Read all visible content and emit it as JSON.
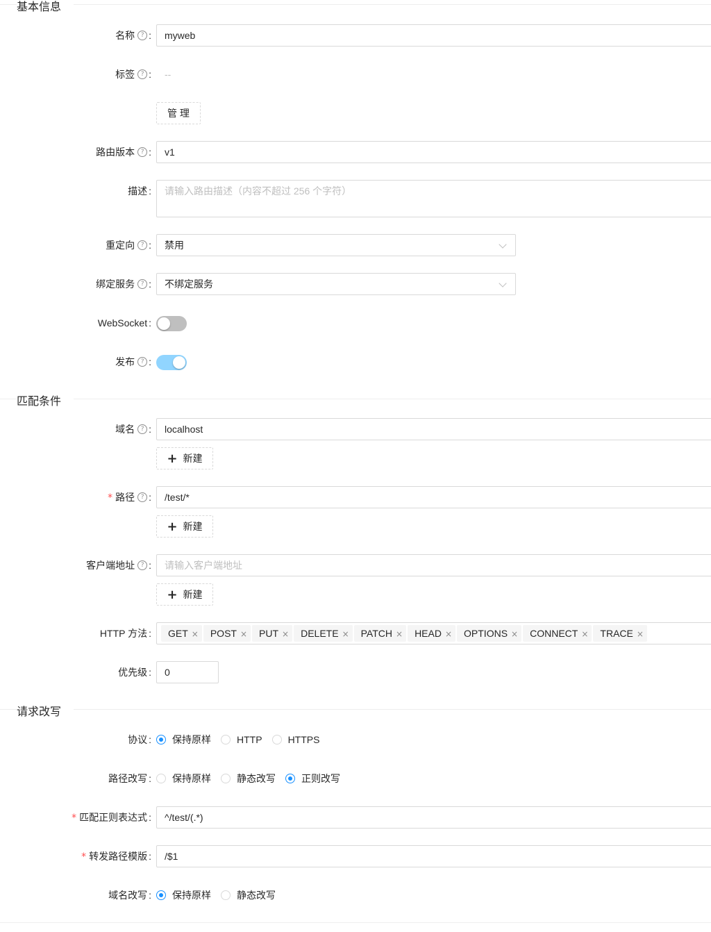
{
  "sections": {
    "basic": "基本信息",
    "match": "匹配条件",
    "rewrite": "请求改写"
  },
  "form": {
    "name": {
      "label": "名称",
      "value": "myweb"
    },
    "tags": {
      "label": "标签",
      "value": "--",
      "manage_button": "管 理"
    },
    "version": {
      "label": "路由版本",
      "value": "v1"
    },
    "description": {
      "label": "描述",
      "placeholder": "请输入路由描述（内容不超过 256 个字符）"
    },
    "redirect": {
      "label": "重定向",
      "value": "禁用"
    },
    "bind_service": {
      "label": "绑定服务",
      "value": "不绑定服务"
    },
    "websocket": {
      "label": "WebSocket",
      "enabled": false
    },
    "publish": {
      "label": "发布",
      "enabled": true
    },
    "domain": {
      "label": "域名",
      "value": "localhost",
      "add_button": "新建"
    },
    "path": {
      "label": "路径",
      "value": "/test/*",
      "add_button": "新建"
    },
    "client_address": {
      "label": "客户端地址",
      "placeholder": "请输入客户端地址",
      "add_button": "新建"
    },
    "http_methods": {
      "label": "HTTP 方法",
      "values": [
        "GET",
        "POST",
        "PUT",
        "DELETE",
        "PATCH",
        "HEAD",
        "OPTIONS",
        "CONNECT",
        "TRACE"
      ]
    },
    "priority": {
      "label": "优先级",
      "value": "0"
    },
    "protocol": {
      "label": "协议",
      "options": [
        "保持原样",
        "HTTP",
        "HTTPS"
      ],
      "selected": "保持原样"
    },
    "path_rewrite": {
      "label": "路径改写",
      "options": [
        "保持原样",
        "静态改写",
        "正则改写"
      ],
      "selected": "正则改写"
    },
    "regex": {
      "label": "匹配正则表达式",
      "value": "^/test/(.*)"
    },
    "forward_template": {
      "label": "转发路径模版",
      "value": "/$1"
    },
    "host_rewrite": {
      "label": "域名改写",
      "options": [
        "保持原样",
        "静态改写"
      ],
      "selected": "保持原样"
    }
  },
  "symbols": {
    "required": "*",
    "help": "?",
    "colon": ":",
    "plus": "+",
    "remove": "×"
  },
  "colors": {
    "primary": "#1890ff",
    "required": "#ff4d4f",
    "switch_on": "#91d5ff",
    "switch_off": "#bfbfbf"
  }
}
